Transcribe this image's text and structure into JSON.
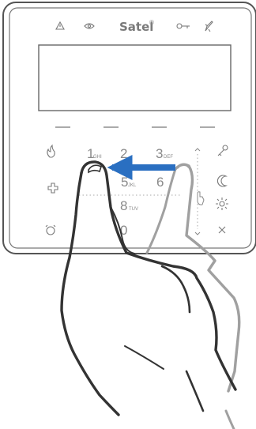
{
  "brand": "Satel",
  "brand_mark": "®",
  "status_icons": [
    "alarm-triangle-icon",
    "eye-icon",
    "key-icon",
    "rocket-icon"
  ],
  "function_keys": [
    "—",
    "—",
    "—",
    "—"
  ],
  "left_keys": [
    "fire-icon",
    "first-aid-icon",
    "panic-icon"
  ],
  "keys": {
    "k1": "1",
    "k1_sub": "GHI",
    "k2": "2",
    "k3": "3",
    "k3_sub": "DEF",
    "k5": "5",
    "k5_sub": "JKL",
    "k6": "6",
    "k8": "8",
    "k8_sub": "TUV",
    "k0": "0"
  },
  "right_keys": [
    "key-icon",
    "moon-icon",
    "sun-icon",
    "close-icon"
  ],
  "gesture": {
    "type": "swipe",
    "direction": "left",
    "fingers": 2
  },
  "colors": {
    "arrow": "#2a6fc1",
    "frame": "#555555",
    "hand_front": "#333333",
    "hand_back": "#a0a0a0"
  }
}
